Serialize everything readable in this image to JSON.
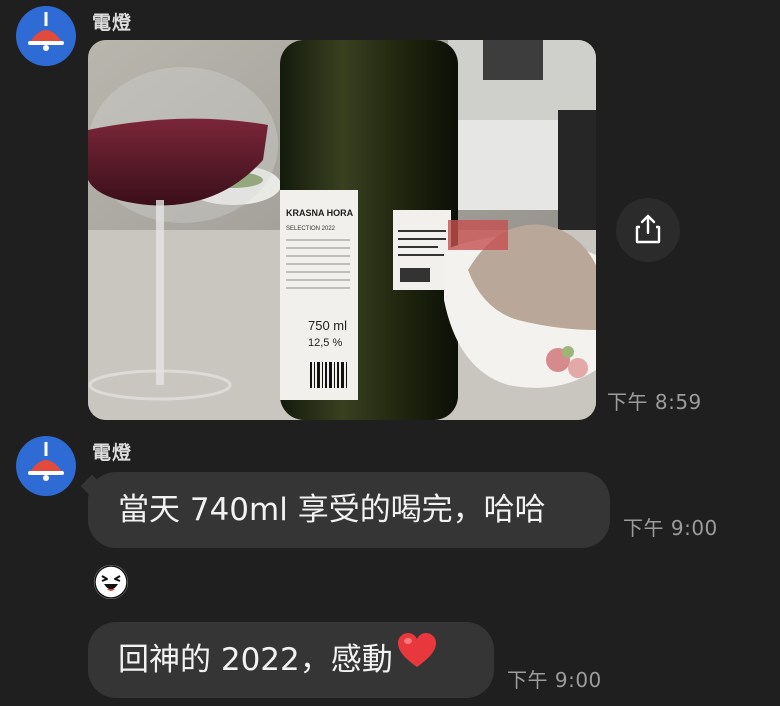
{
  "messages": [
    {
      "sender": "電燈",
      "type": "photo",
      "time": "下午 8:59"
    },
    {
      "sender": "電燈",
      "type": "text",
      "text": "當天 740ml 享受的喝完，哈哈",
      "time": "下午 9:00"
    },
    {
      "type": "sticker",
      "sticker_icon": "laughing-face-sticker"
    },
    {
      "type": "text",
      "text": "回神的 2022，感動",
      "emoji": "❤️",
      "time": "下午 9:00"
    }
  ],
  "photo_content": {
    "label_brand": "KRASNA HORA",
    "label_line": "SELECTION 2022",
    "volume": "750 ml",
    "abv": "12,5 %"
  },
  "colors": {
    "background": "#1f1f1f",
    "bubble": "#353535",
    "avatar": "#2f6bd4",
    "lamp": "#e24a3b",
    "timestamp": "#9c9c9c"
  },
  "icons": {
    "avatar": "lamp-icon",
    "share": "share-icon",
    "heart": "heart-icon"
  }
}
